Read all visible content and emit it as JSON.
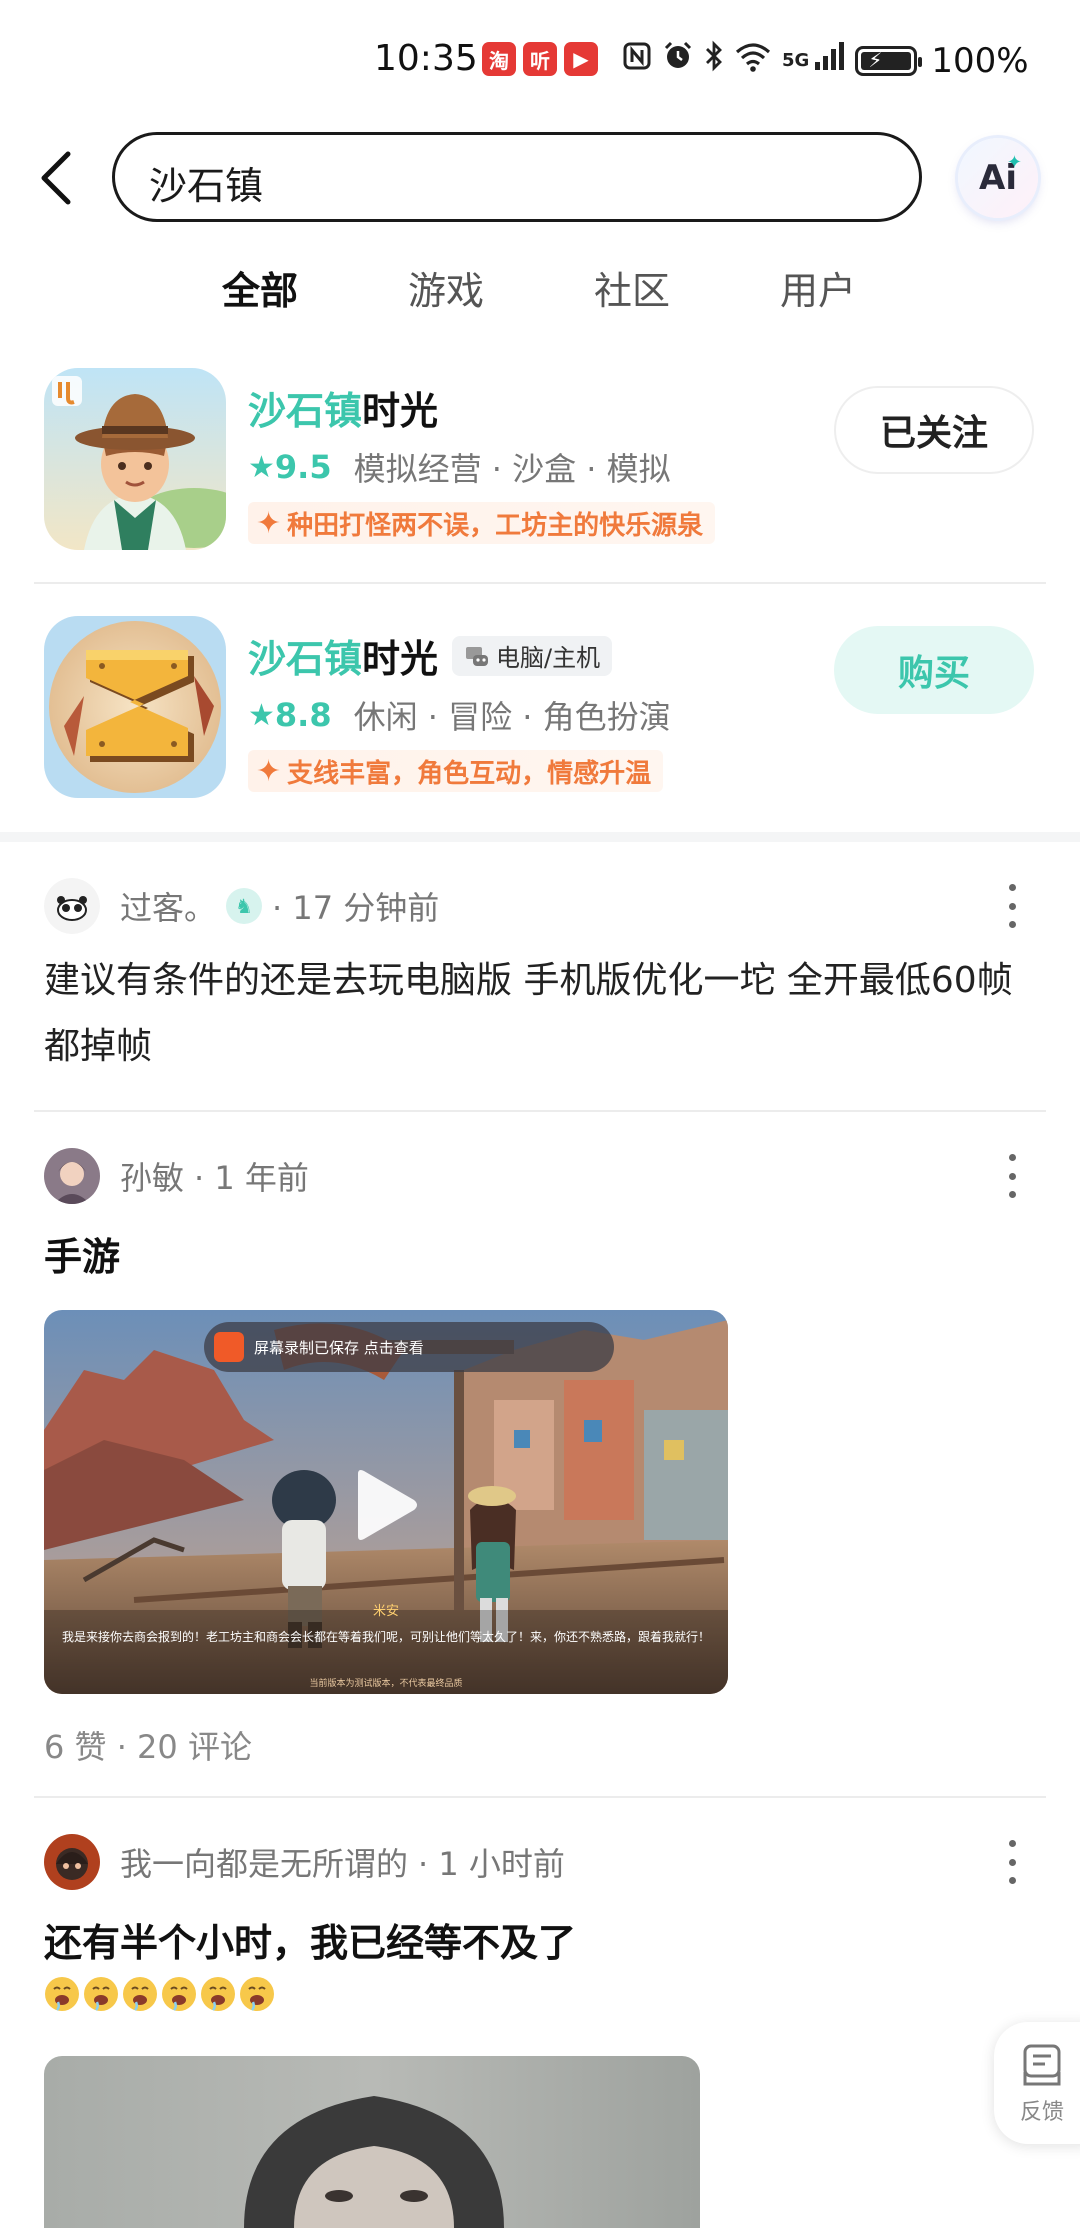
{
  "status_bar": {
    "time": "10:35",
    "app_icons": [
      "淘",
      "听",
      "▶"
    ],
    "network": "5G",
    "battery": "100%"
  },
  "search": {
    "query": "沙石镇",
    "ai_label": "Ai"
  },
  "tabs": [
    {
      "label": "全部",
      "active": true
    },
    {
      "label": "游戏",
      "active": false
    },
    {
      "label": "社区",
      "active": false
    },
    {
      "label": "用户",
      "active": false
    }
  ],
  "games": [
    {
      "title_highlight": "沙石镇",
      "title_rest": "时光",
      "rating": "9.5",
      "tags": "模拟经营 · 沙盒 · 模拟",
      "highlight": "种田打怪两不误，工坊主的快乐源泉",
      "action": "已关注"
    },
    {
      "title_highlight": "沙石镇",
      "title_rest": "时光",
      "platform": "电脑/主机",
      "rating": "8.8",
      "tags": "休闲 · 冒险 · 角色扮演",
      "highlight": "支线丰富，角色互动，情感升温",
      "action": "购买"
    }
  ],
  "posts": [
    {
      "author": "过客。",
      "time": "· 17 分钟前",
      "body": "建议有条件的还是去玩电脑版 手机版优化一坨 全开最低60帧 都掉帧"
    },
    {
      "author": "孙敏",
      "time": "· 1 年前",
      "title": "手游",
      "video": {
        "banner": "屏幕录制已保存  点击查看",
        "speaker": "米安",
        "subtitle": "我是来接你去商会报到的！老工坊主和商会会长都在等着我们呢，可别让他们等太久了！来，你还不熟悉路，跟着我就行！",
        "footer": "当前版本为测试版本，不代表最终品质"
      },
      "stats": "6 赞 · 20 评论"
    },
    {
      "author": "我一向都是无所谓的",
      "time": "· 1 小时前",
      "title": "还有半个小时，我已经等不及了",
      "emoji_count": 6
    }
  ],
  "feedback": {
    "label": "反馈"
  },
  "colors": {
    "accent": "#3cc6ac",
    "orange": "#f07a3c"
  }
}
